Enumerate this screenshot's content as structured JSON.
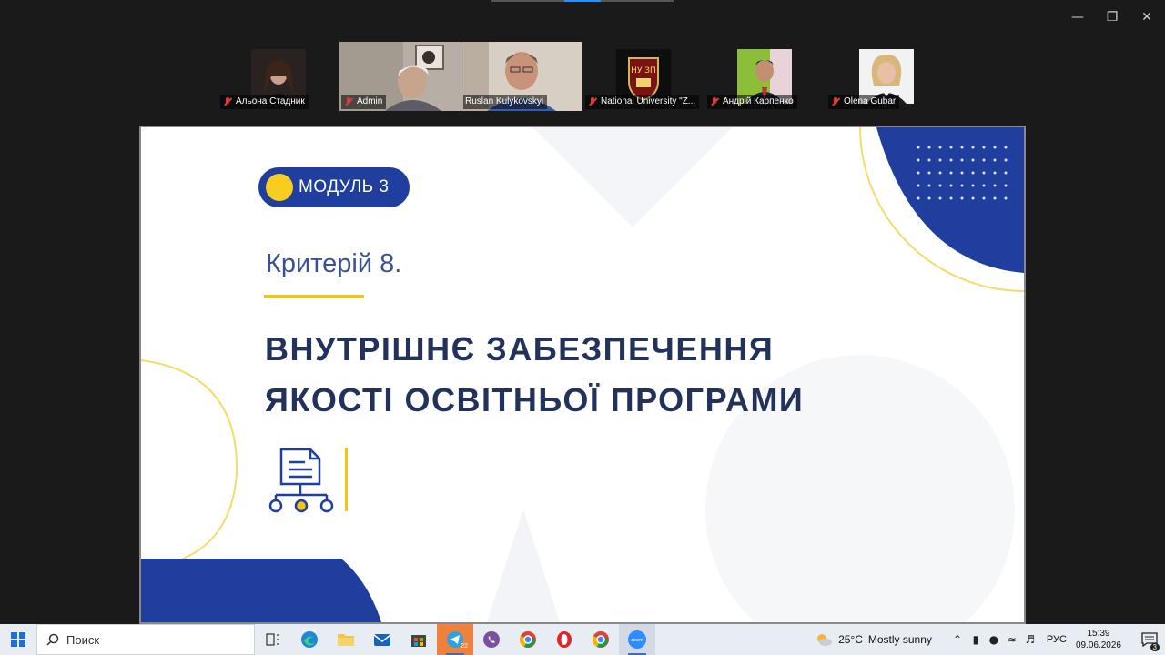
{
  "participants": [
    {
      "name": "Альона Стадник",
      "muted": true
    },
    {
      "name": "Admin",
      "muted": true
    },
    {
      "name": "Ruslan Kulykovskyi",
      "muted": false,
      "speaking": true
    },
    {
      "name": "National University \"Z...",
      "muted": true
    },
    {
      "name": "Андрій Карпенко",
      "muted": true
    },
    {
      "name": "Olena Gubar",
      "muted": true
    }
  ],
  "slide": {
    "module_label": "МОДУЛЬ 3",
    "criterion": "Критерій 8.",
    "title_line1": "ВНУТРІШНЄ ЗАБЕЗПЕЧЕННЯ",
    "title_line2": "ЯКОСТІ ОСВІТНЬОЇ ПРОГРАМИ",
    "logo_letters": "НУ ЗП"
  },
  "taskbar": {
    "search_placeholder": "Поиск",
    "weather_temp": "25°C",
    "weather_desc": "Mostly sunny",
    "language": "РУС",
    "time": "15:39",
    "date": "09.06.2026",
    "telegram_badge": "22",
    "notification_count": "3",
    "zoom_label": "zoom"
  },
  "colors": {
    "slide_blue": "#1f3e9e",
    "slide_yellow": "#f2c516",
    "title_color": "#23325a",
    "speaking_border": "#3ec277"
  }
}
